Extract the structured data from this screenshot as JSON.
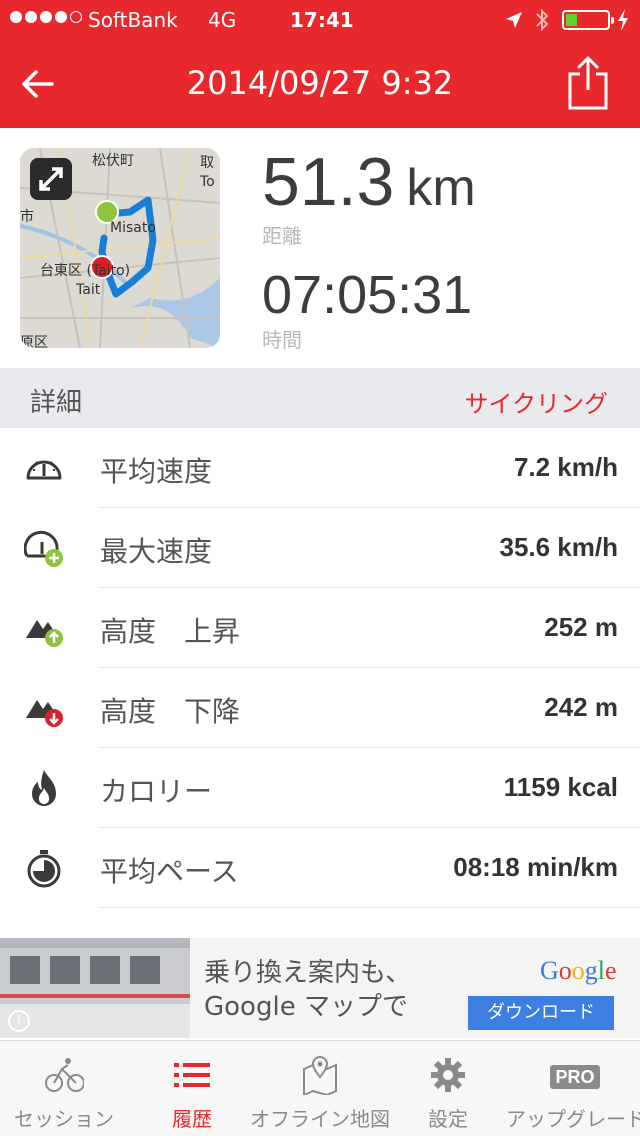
{
  "status_bar": {
    "carrier": "SoftBank",
    "network": "4G",
    "time": "17:41"
  },
  "nav": {
    "title": "2014/09/27 9:32"
  },
  "map": {
    "labels": [
      "松伏町",
      "取",
      "To",
      "市",
      "Misato",
      "台東区 (Taito)",
      "Tait",
      "原区"
    ]
  },
  "summary": {
    "distance_value": "51.3",
    "distance_unit": "km",
    "distance_label": "距離",
    "duration_value": "07:05:31",
    "duration_label": "時間"
  },
  "details": {
    "title": "詳細",
    "activity_type": "サイクリング",
    "rows": [
      {
        "label": "平均速度",
        "value": "7.2 km/h",
        "icon": "speedometer-icon"
      },
      {
        "label": "最大速度",
        "value": "35.6 km/h",
        "icon": "max-speed-icon"
      },
      {
        "label": "高度　上昇",
        "value": "252 m",
        "icon": "elevation-up-icon"
      },
      {
        "label": "高度　下降",
        "value": "242 m",
        "icon": "elevation-down-icon"
      },
      {
        "label": "カロリー",
        "value": "1159 kcal",
        "icon": "flame-icon"
      },
      {
        "label": "平均ペース",
        "value": "08:18 min/km",
        "icon": "stopwatch-icon"
      }
    ]
  },
  "ad": {
    "line1": "乗り換え案内も、",
    "line2": "Google マップで",
    "brand": "Google",
    "cta": "ダウンロード",
    "info": "i"
  },
  "tabs": [
    {
      "label": "セッション",
      "icon": "cyclist-icon",
      "active": false
    },
    {
      "label": "履歴",
      "icon": "list-icon",
      "active": true
    },
    {
      "label": "オフライン地図",
      "icon": "offline-map-icon",
      "active": false
    },
    {
      "label": "設定",
      "icon": "gear-icon",
      "active": false
    },
    {
      "label": "アップグレード",
      "icon": "pro-icon",
      "badge": "PRO",
      "active": false
    }
  ],
  "colors": {
    "accent": "#e8282d",
    "start_marker": "#8cc63f",
    "end_marker": "#d8202a",
    "route": "#1a7fd4"
  }
}
